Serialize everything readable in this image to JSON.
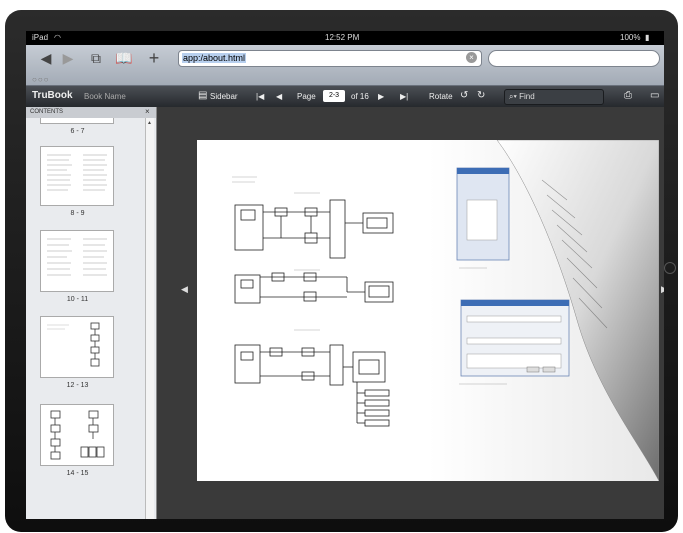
{
  "status": {
    "device": "iPad",
    "time": "12:52 PM",
    "battery": "100%"
  },
  "browser": {
    "url": "app:/about.html",
    "window_dots": "○○○"
  },
  "app": {
    "brand": "TruBook",
    "book_name": "Book Name",
    "sidebar_label": "Sidebar",
    "page_label": "Page",
    "page_value": "2-3",
    "page_total": "of 16",
    "rotate_label": "Rotate",
    "find_label": "Find"
  },
  "sidebar": {
    "header": "CONTENTS",
    "thumbs": [
      {
        "label": "6 - 7"
      },
      {
        "label": "8 - 9"
      },
      {
        "label": "10 - 11"
      },
      {
        "label": "12 - 13"
      },
      {
        "label": "14 - 15"
      }
    ]
  },
  "colors": {
    "accent": "#b7cfee",
    "toolbar": "#2f3237"
  }
}
